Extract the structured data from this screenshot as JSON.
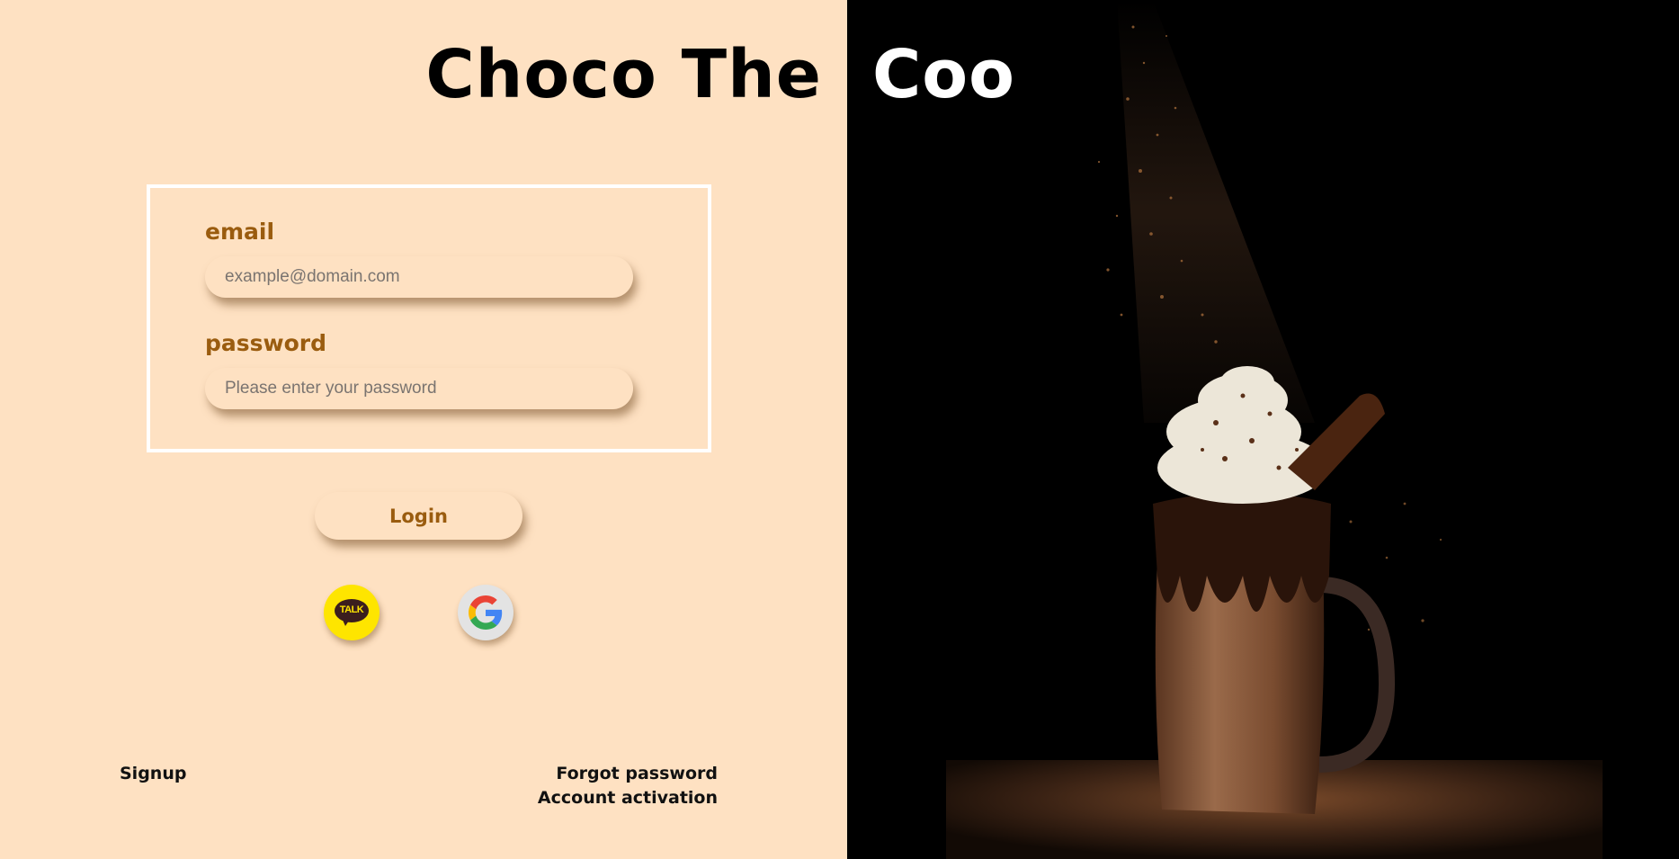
{
  "header": {
    "title_left": "Choco The",
    "title_right": "Coo"
  },
  "login_form": {
    "email_label": "email",
    "email_placeholder": "example@domain.com",
    "email_value": "",
    "password_label": "password",
    "password_placeholder": "Please enter your password",
    "password_value": "",
    "login_button_label": "Login"
  },
  "social_login": {
    "kakao_icon_text": "TALK",
    "kakao_color": "#fee500",
    "google_icon": "google-g-icon"
  },
  "footer": {
    "signup_label": "Signup",
    "forgot_password_label": "Forgot password",
    "account_activation_label": "Account activation"
  },
  "colors": {
    "background_left": "#fee1c2",
    "background_right": "#000000",
    "accent_brown": "#9a5c0f"
  }
}
